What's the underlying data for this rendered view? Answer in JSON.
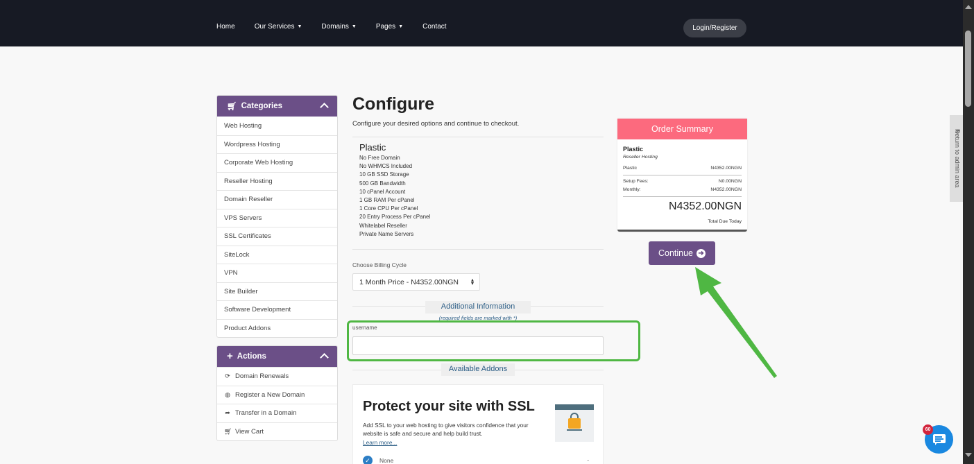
{
  "nav": {
    "items": [
      {
        "label": "Home",
        "dropdown": false
      },
      {
        "label": "Our Services",
        "dropdown": true
      },
      {
        "label": "Domains",
        "dropdown": true
      },
      {
        "label": "Pages",
        "dropdown": true
      },
      {
        "label": "Contact",
        "dropdown": false
      }
    ],
    "login_label": "Login/Register"
  },
  "sidebar": {
    "categories": {
      "title": "Categories",
      "icon": "cart-icon",
      "items": [
        "Web Hosting",
        "Wordpress Hosting",
        "Corporate Web Hosting",
        "Reseller Hosting",
        "Domain Reseller",
        "VPS Servers",
        "SSL Certificates",
        "SiteLock",
        "VPN",
        "Site Builder",
        "Software Development",
        "Product Addons"
      ]
    },
    "actions": {
      "title": "Actions",
      "icon": "plus-icon",
      "items": [
        {
          "label": "Domain Renewals",
          "icon": "refresh-icon"
        },
        {
          "label": "Register a New Domain",
          "icon": "globe-icon"
        },
        {
          "label": "Transfer in a Domain",
          "icon": "share-icon"
        },
        {
          "label": "View Cart",
          "icon": "cart-icon"
        }
      ]
    }
  },
  "main": {
    "title": "Configure",
    "subtitle": "Configure your desired options and continue to checkout.",
    "product": {
      "name": "Plastic",
      "features": [
        "No Free Domain",
        "No WHMCS Included",
        "10 GB SSD Storage",
        "500 GB Bandwidth",
        "10 cPanel Account",
        "1 GB RAM Per cPanel",
        "1 Core CPU Per cPanel",
        "20 Entry Process Per cPanel",
        "Whitelabel Reseller",
        "Private Name Servers"
      ]
    },
    "billing": {
      "label": "Choose Billing Cycle",
      "selected": "1 Month Price - N4352.00NGN"
    },
    "additional_info": {
      "title": "Additional Information",
      "note": "(required fields are marked with *)",
      "username_label": "username",
      "username_value": ""
    },
    "addons": {
      "title": "Available Addons",
      "card": {
        "title": "Protect your site with SSL",
        "description": "Add SSL to your web hosting to give visitors confidence that your website is safe and secure and help build trust.",
        "link": "Learn more...",
        "option_label": "None",
        "option_price": "-"
      }
    }
  },
  "summary": {
    "title": "Order Summary",
    "product": "Plastic",
    "category": "Reseller Hosting",
    "line_label": "Plastic",
    "line_price": "N4352.00NGN",
    "setup_label": "Setup Fees:",
    "setup_value": "N0.00NGN",
    "monthly_label": "Monthly:",
    "monthly_value": "N4352.00NGN",
    "total": "N4352.00NGN",
    "total_label": "Total Due Today"
  },
  "continue_label": "Continue",
  "admin_tab_label": "Return to admin area",
  "chat_badge_count": "60",
  "colors": {
    "nav_bg": "#171a24",
    "accent_purple": "#6b4f87",
    "summary_header": "#fc6a7e",
    "link_blue": "#2b5d85",
    "highlight_green": "#4fb743",
    "chat_blue": "#1a88e0"
  }
}
